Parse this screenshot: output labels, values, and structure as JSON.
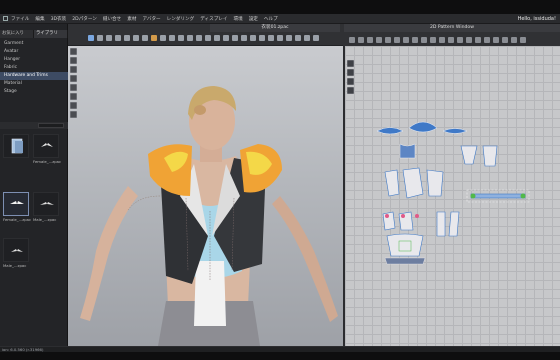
{
  "menubar": {
    "items": [
      "ファイル",
      "編集",
      "3D衣装",
      "2Dパターン",
      "縫い合せ",
      "素材",
      "アバター",
      "レンダリング",
      "ディスプレイ",
      "環境",
      "設定",
      "ヘルプ"
    ],
    "user": "Hello, issiduda!"
  },
  "viewport": {
    "file_title": "衣装01.zpac"
  },
  "pattern_window": {
    "title": "2D Pattern Window"
  },
  "library": {
    "tabs": [
      "お気に入り",
      "ライブラリ"
    ],
    "items": [
      "Garment",
      "Avatar",
      "Hanger",
      "Fabric",
      "Hardware and Trims",
      "Material",
      "Stage"
    ],
    "selected_index": 4,
    "thumbnails": [
      {
        "label": ""
      },
      {
        "label": "Female_...zpac"
      },
      {
        "label": "Female_...zpac"
      },
      {
        "label": "Male_...zpac"
      },
      {
        "label": "Male_...zpac"
      }
    ]
  },
  "status": {
    "version": "ion: 6.0.560 (r.31966)"
  },
  "colors": {
    "accent": "#3d4b63",
    "jacket": "#2f3135",
    "lining": "#f0a335",
    "dress": "#a9d6e8",
    "pattern_blue": "#3f79c7"
  }
}
